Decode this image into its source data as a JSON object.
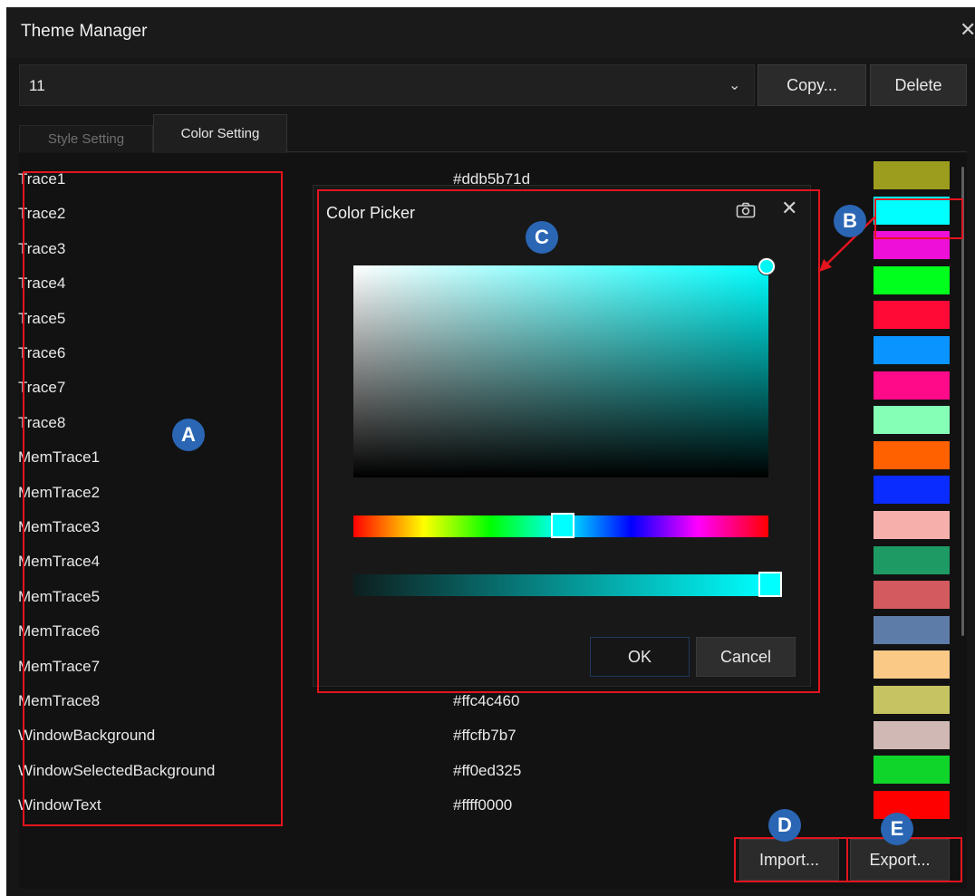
{
  "window": {
    "title": "Theme Manager",
    "close": "✕"
  },
  "theme_select": {
    "value": "11",
    "arrow": "⌄"
  },
  "buttons": {
    "copy": "Copy...",
    "delete": "Delete",
    "import": "Import...",
    "export": "Export..."
  },
  "tabs": {
    "style": "Style Setting",
    "color": "Color Setting"
  },
  "color_items": [
    {
      "name": "Trace1",
      "hex": "#ddb5b71d",
      "swatch": "#9c9c1e"
    },
    {
      "name": "Trace2",
      "hex": "",
      "swatch": "#00ffff"
    },
    {
      "name": "Trace3",
      "hex": "",
      "swatch": "#ee10d8"
    },
    {
      "name": "Trace4",
      "hex": "",
      "swatch": "#00ff1c"
    },
    {
      "name": "Trace5",
      "hex": "",
      "swatch": "#ff0a37"
    },
    {
      "name": "Trace6",
      "hex": "",
      "swatch": "#0a94ff"
    },
    {
      "name": "Trace7",
      "hex": "",
      "swatch": "#ff0a89"
    },
    {
      "name": "Trace8",
      "hex": "",
      "swatch": "#86ffb6"
    },
    {
      "name": "MemTrace1",
      "hex": "",
      "swatch": "#ff6000"
    },
    {
      "name": "MemTrace2",
      "hex": "",
      "swatch": "#0a2cff"
    },
    {
      "name": "MemTrace3",
      "hex": "",
      "swatch": "#f7afab"
    },
    {
      "name": "MemTrace4",
      "hex": "",
      "swatch": "#1e9a64"
    },
    {
      "name": "MemTrace5",
      "hex": "",
      "swatch": "#d35a5e"
    },
    {
      "name": "MemTrace6",
      "hex": "",
      "swatch": "#5d7ca8"
    },
    {
      "name": "MemTrace7",
      "hex": "",
      "swatch": "#fbc986"
    },
    {
      "name": "MemTrace8",
      "hex": "#ffc4c460",
      "swatch": "#c6c462"
    },
    {
      "name": "WindowBackground",
      "hex": "#ffcfb7b7",
      "swatch": "#d0b8b4"
    },
    {
      "name": "WindowSelectedBackground",
      "hex": "#ff0ed325",
      "swatch": "#0fd42a"
    },
    {
      "name": "WindowText",
      "hex": "#ffff0000",
      "swatch": "#ff0000"
    }
  ],
  "color_picker": {
    "title": "Color Picker",
    "camera_icon": "camera-icon",
    "close": "✕",
    "ok": "OK",
    "cancel": "Cancel",
    "current_color": "#00ffff"
  },
  "markers": {
    "a": "A",
    "b": "B",
    "c": "C",
    "d": "D",
    "e": "E"
  },
  "highlight_color": "#e3141e",
  "marker_color": "#2a66b4"
}
